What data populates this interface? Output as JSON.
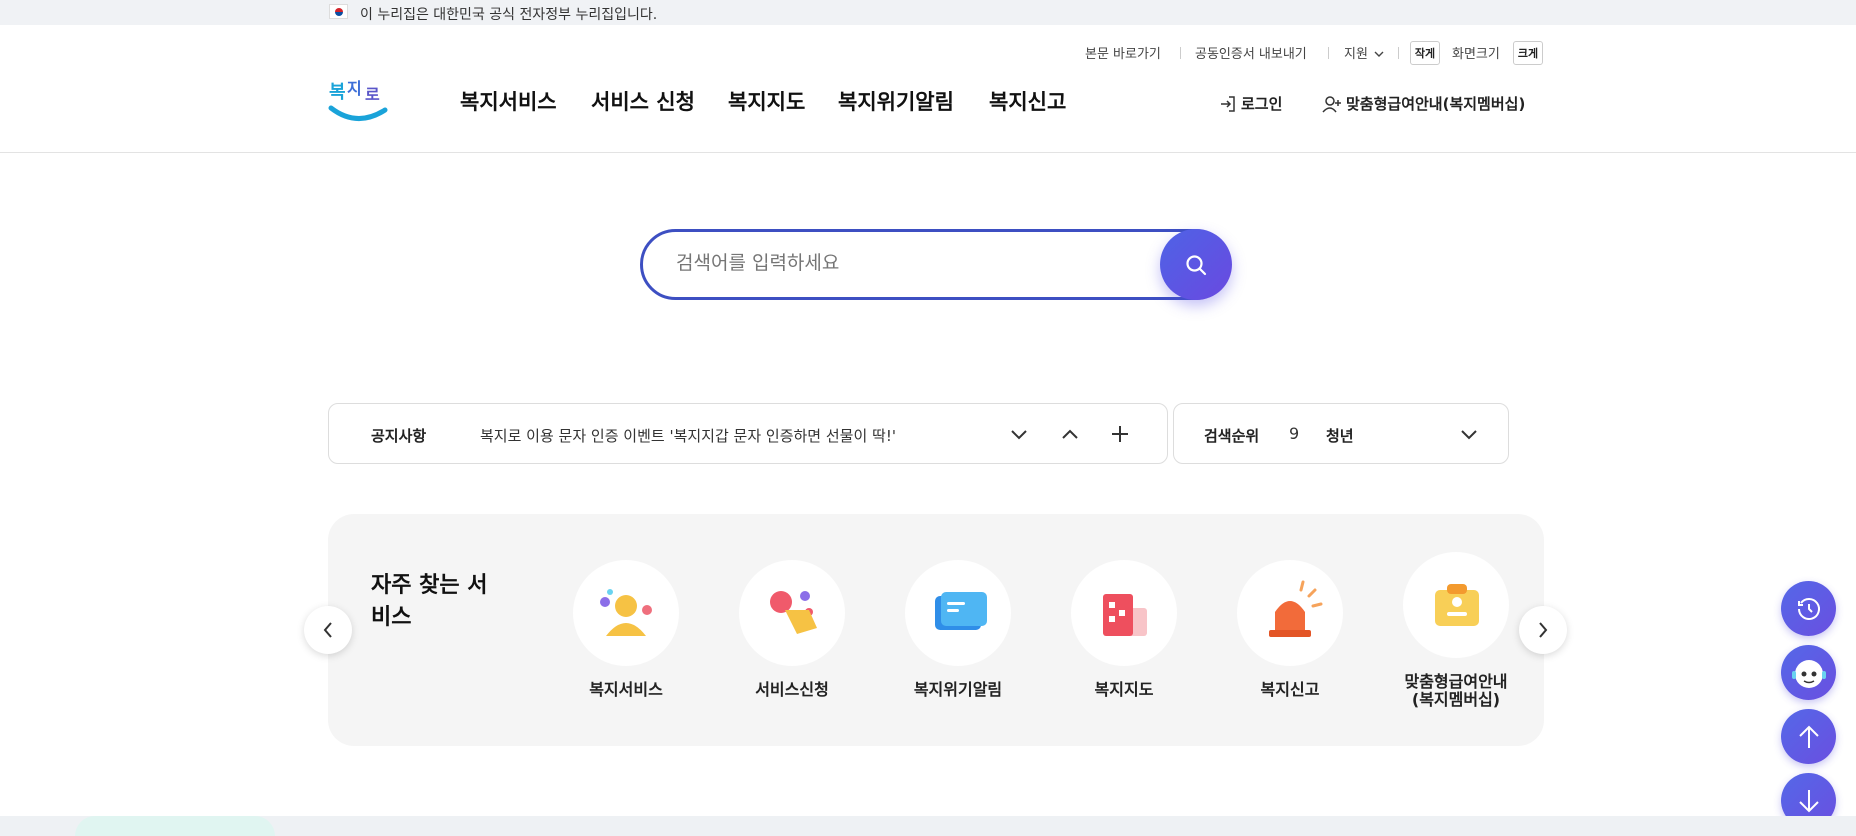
{
  "gov_banner": {
    "text": "이 누리집은 대한민국 공식 전자정부 누리집입니다."
  },
  "utility": {
    "skip": "본문 바로가기",
    "cert": "공동인증서 내보내기",
    "support": "지원",
    "small": "작게",
    "screen_size": "화면크기",
    "large": "크게"
  },
  "logo": {
    "text": "복지로"
  },
  "nav": [
    "복지서비스",
    "서비스 신청",
    "복지지도",
    "복지위기알림",
    "복지신고"
  ],
  "header_links": {
    "login": "로그인",
    "membership": "맞춤형급여안내(복지멤버십)"
  },
  "search": {
    "placeholder": "검색어를 입력하세요"
  },
  "notice": {
    "title": "공지사항",
    "text": "복지로 이용 문자 인증 이벤트 '복지지갑 문자 인증하면 선물이 딱!'"
  },
  "rank": {
    "title": "검색순위",
    "number": "9",
    "keyword": "청년"
  },
  "frequent": {
    "title": "자주 찾는 서비스",
    "items": [
      {
        "label": "복지서비스",
        "icon": "person-icon"
      },
      {
        "label": "서비스신청",
        "icon": "hand-click-icon"
      },
      {
        "label": "복지위기알림",
        "icon": "message-icon"
      },
      {
        "label": "복지지도",
        "icon": "building-icon"
      },
      {
        "label": "복지신고",
        "icon": "siren-icon"
      },
      {
        "label": "맞춤형급여안내(복지멤버십)",
        "label_line1": "맞춤형급여안내",
        "label_line2": "(복지멤버십)",
        "icon": "clipboard-icon"
      }
    ]
  },
  "colors": {
    "brand": "#3d4fc2",
    "accent": "#5468e8"
  }
}
